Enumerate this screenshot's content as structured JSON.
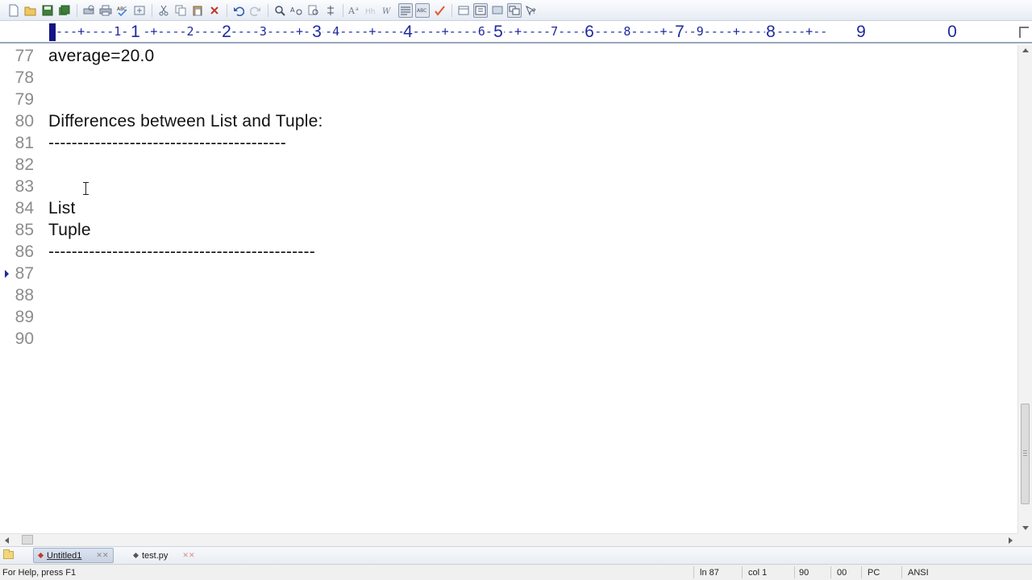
{
  "toolbar": {
    "icons": [
      "new-file-icon",
      "open-folder-icon",
      "save-icon",
      "save-all-icon",
      "print-preview-icon",
      "print-icon",
      "spell-check-icon",
      "toggle-icon",
      "cut-icon",
      "copy-icon",
      "paste-icon",
      "delete-icon",
      "undo-icon",
      "redo-icon",
      "find-icon",
      "replace-icon",
      "find-in-files-icon",
      "goto-icon",
      "font-icon",
      "case-icon",
      "word-wrap-icon",
      "ruler-toggle-icon",
      "spell-icon",
      "checkmark-icon",
      "view-icon",
      "window-icon",
      "screen-icon",
      "tile-icon",
      "help-icon"
    ]
  },
  "ruler": {
    "digits": [
      "1",
      "2",
      "3",
      "4",
      "5",
      "6",
      "7",
      "8",
      "9",
      "0"
    ],
    "pattern": "---+----1----+----2----+----3----+----4----+----5----+----6----+----7----+----8----+----9----+----0----+--"
  },
  "editor": {
    "lines": [
      {
        "num": "77",
        "text": "average=20.0"
      },
      {
        "num": "78",
        "text": ""
      },
      {
        "num": "79",
        "text": ""
      },
      {
        "num": "80",
        "text": "Differences between List and Tuple:"
      },
      {
        "num": "81",
        "text": "-----------------------------------------"
      },
      {
        "num": "82",
        "text": ""
      },
      {
        "num": "83",
        "text": ""
      },
      {
        "num": "84",
        "text": "List"
      },
      {
        "num": "85",
        "text": "Tuple"
      },
      {
        "num": "86",
        "text": "----------------------------------------------"
      },
      {
        "num": "87",
        "text": ""
      },
      {
        "num": "88",
        "text": ""
      },
      {
        "num": "89",
        "text": ""
      },
      {
        "num": "90",
        "text": ""
      }
    ],
    "current_line": "87"
  },
  "tabs": [
    {
      "label": "Untitled1",
      "active": true
    },
    {
      "label": "test.py",
      "active": false
    }
  ],
  "status": {
    "help": "For Help, press F1",
    "line": "ln 87",
    "col": "col 1",
    "total": "90",
    "code": "00",
    "mode": "PC",
    "encoding": "ANSI"
  },
  "colors": {
    "ruler_text": "#1e2aa0",
    "line_number": "#8c8c8c",
    "code_text": "#111111"
  }
}
